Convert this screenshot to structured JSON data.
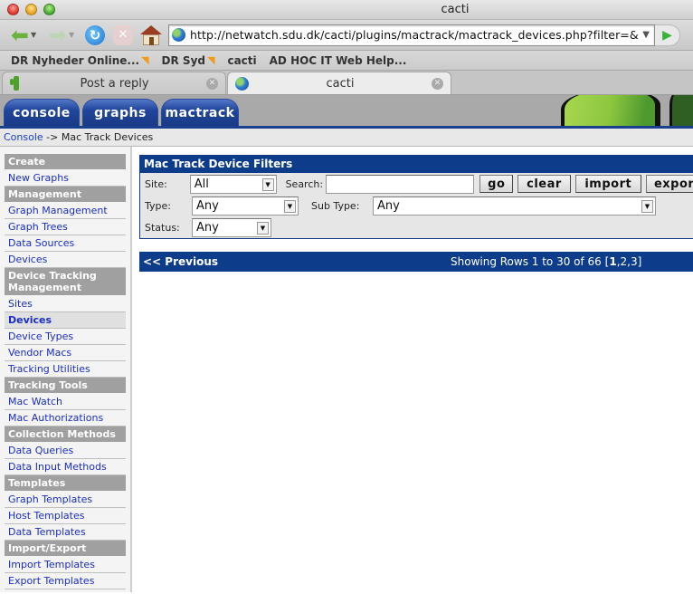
{
  "browser": {
    "window_title": "cacti",
    "url": "http://netwatch.sdu.dk/cacti/plugins/mactrack/mactrack_devices.php?filter=&site_id=",
    "bookmarks": [
      {
        "label": "DR Nyheder Online...",
        "rss": true
      },
      {
        "label": "DR Syd",
        "rss": true
      },
      {
        "label": "cacti",
        "rss": false
      },
      {
        "label": "AD HOC IT Web Help...",
        "rss": false
      }
    ],
    "tabs": [
      {
        "label": "Post a reply",
        "icon": "cactus-icon",
        "active": false
      },
      {
        "label": "cacti",
        "icon": "globe-icon",
        "active": true
      }
    ]
  },
  "cacti": {
    "tabs": [
      {
        "label": "console"
      },
      {
        "label": "graphs"
      },
      {
        "label": "mactrack"
      }
    ],
    "breadcrumb": {
      "link": "Console",
      "separator": "->",
      "current": "Mac Track Devices"
    },
    "sidebar": [
      {
        "type": "header",
        "label": "Create"
      },
      {
        "type": "item",
        "label": "New Graphs"
      },
      {
        "type": "header",
        "label": "Management"
      },
      {
        "type": "item",
        "label": "Graph Management"
      },
      {
        "type": "item",
        "label": "Graph Trees"
      },
      {
        "type": "item",
        "label": "Data Sources"
      },
      {
        "type": "item",
        "label": "Devices"
      },
      {
        "type": "header",
        "label": "Device Tracking Management"
      },
      {
        "type": "item",
        "label": "Sites"
      },
      {
        "type": "item",
        "label": "Devices",
        "selected": true
      },
      {
        "type": "item",
        "label": "Device Types"
      },
      {
        "type": "item",
        "label": "Vendor Macs"
      },
      {
        "type": "item",
        "label": "Tracking Utilities"
      },
      {
        "type": "header",
        "label": "Tracking Tools"
      },
      {
        "type": "item",
        "label": "Mac Watch"
      },
      {
        "type": "item",
        "label": "Mac Authorizations"
      },
      {
        "type": "header",
        "label": "Collection Methods"
      },
      {
        "type": "item",
        "label": "Data Queries"
      },
      {
        "type": "item",
        "label": "Data Input Methods"
      },
      {
        "type": "header",
        "label": "Templates"
      },
      {
        "type": "item",
        "label": "Graph Templates"
      },
      {
        "type": "item",
        "label": "Host Templates"
      },
      {
        "type": "item",
        "label": "Data Templates"
      },
      {
        "type": "header",
        "label": "Import/Export"
      },
      {
        "type": "item",
        "label": "Import Templates"
      },
      {
        "type": "item",
        "label": "Export Templates"
      }
    ],
    "filters": {
      "title": "Mac Track Device Filters",
      "site_label": "Site:",
      "site_value": "All",
      "search_label": "Search:",
      "search_value": "",
      "type_label": "Type:",
      "type_value": "Any",
      "subtype_label": "Sub Type:",
      "subtype_value": "Any",
      "status_label": "Status:",
      "status_value": "Any",
      "buttons": {
        "go": "go",
        "clear": "clear",
        "import": "import",
        "export": "export"
      }
    },
    "pager": {
      "previous": "<< Previous",
      "rows_info": "Showing Rows 1 to 30 of 66",
      "pages": [
        "1",
        "2",
        "3"
      ],
      "current_page": "1"
    }
  },
  "colors": {
    "nav_blue": "#0d3d8a",
    "link_blue": "#1a2ec4",
    "menu_header_gray": "#a0a0a0"
  }
}
